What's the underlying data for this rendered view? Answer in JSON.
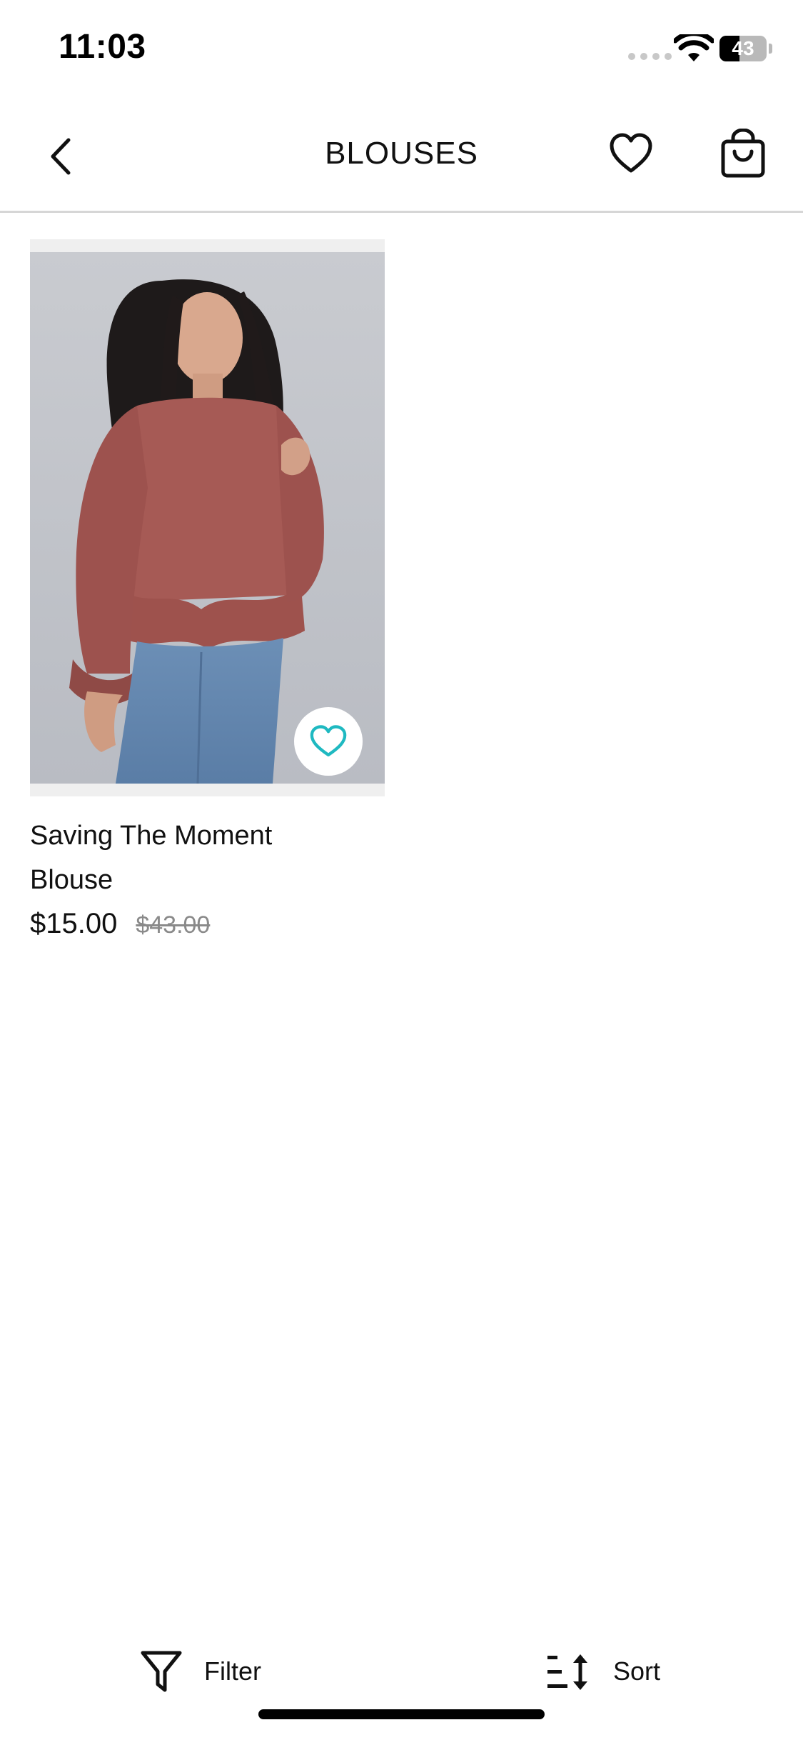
{
  "status_bar": {
    "time": "11:03",
    "battery_percent": "43",
    "battery_level": 0.43
  },
  "header": {
    "title": "BLOUSES",
    "icons": [
      "chevron-left-icon",
      "heart-icon",
      "shopping-bag-icon"
    ]
  },
  "products": [
    {
      "name": "Saving The Moment Blouse",
      "sale_price": "$15.00",
      "original_price": "$43.00",
      "favorite_icon_color": "#1fb9c1"
    }
  ],
  "bottom_bar": {
    "filter_label": "Filter",
    "sort_label": "Sort",
    "icons": [
      "filter-funnel-icon",
      "sort-icon"
    ]
  }
}
